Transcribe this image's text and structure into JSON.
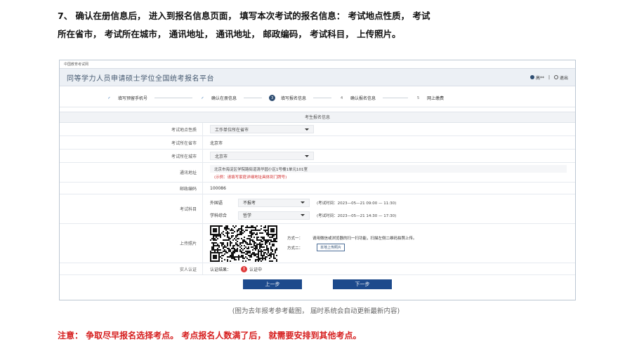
{
  "intro": {
    "line1": "7、 确认在册信息后， 进入到报名信息页面， 填写本次考试的报名信息： 考试地点性质， 考试",
    "line2": "所在省市， 考试所在城市， 通讯地址， 通讯地址， 邮政编码， 考试科目， 上传照片。"
  },
  "screenshot": {
    "source": "中国教育考试网",
    "title": "同等学力人员申请硕士学位全国统考报名平台",
    "user_label": "高**",
    "logout_label": "退出",
    "steps": [
      {
        "num": "✓",
        "label": "填写预留手机号",
        "state": "done"
      },
      {
        "num": "✓",
        "label": "确认在册信息",
        "state": "done"
      },
      {
        "num": "3",
        "label": "填写报名信息",
        "state": "current"
      },
      {
        "num": "4",
        "label": "确认报名信息",
        "state": "todo"
      },
      {
        "num": "5",
        "label": "网上缴费",
        "state": "todo"
      }
    ],
    "form_caption": "考生报名信息",
    "fields": {
      "site_type_label": "考试地点性质",
      "site_type_value": "工作单位所在省市",
      "province_label": "考试所在省市",
      "province_value": "北京市",
      "city_label": "考试所在城市",
      "city_value": "北京市",
      "address_label": "通讯地址",
      "address_value": "北京市海淀区学院路街道清华园小区1号楼1单元101室",
      "address_hint": "(示例：请填写家庭详细地址具体到门牌号)",
      "postal_label": "邮政编码",
      "postal_value": "100086",
      "subject_label": "考试科目",
      "subject1_name": "外国语",
      "subject1_value": "不报考",
      "subject1_time": "(考试时间：2023—05—21 09:00 — 11:30)",
      "subject2_name": "学科综合",
      "subject2_value": "哲学",
      "subject2_time": "(考试时间：2023—05—21 14:30 — 17:30)",
      "photo_label": "上传照片",
      "way1_label": "方式一：",
      "way1_text": "请用微信或浏览器的扫一扫功能，扫描左侧二维码拍照上传。",
      "way2_label": "方式二：",
      "way2_button": "本地上传照片",
      "verify_label": "实人认证",
      "verify_result_label": "认证结果：",
      "verify_status": "认证中"
    },
    "prev_button": "上一步",
    "next_button": "下一步"
  },
  "caption": "(图为去年报考参考截图， 届时系统会自动更新最新内容)",
  "notice": "注意： 争取尽早报名选择考点。 考点报名人数满了后， 就需要安排到其他考点。",
  "colors": {
    "primary": "#1d4a8c",
    "warning": "#d61f1f"
  }
}
